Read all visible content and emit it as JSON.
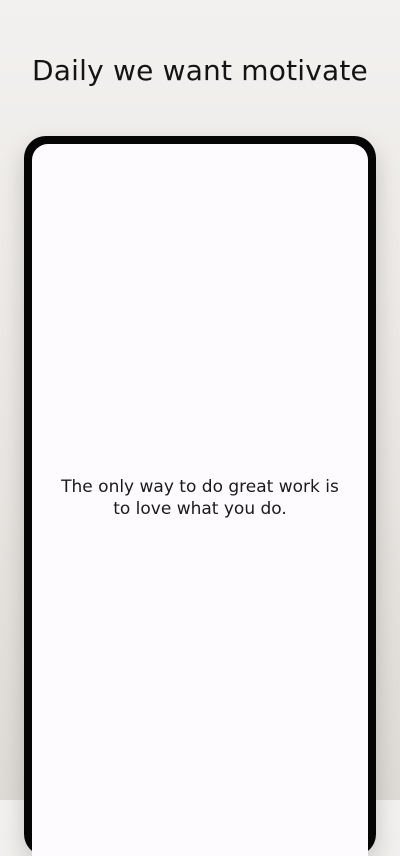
{
  "header": {
    "title": "Daily we want motivate"
  },
  "device": {
    "quote": "The only way to do great work is to love what you do."
  },
  "colors": {
    "background_top": "#f3f1ef",
    "background_bottom": "#dedad6",
    "phone_frame": "#050505",
    "screen": "#fdfbfd",
    "text": "#141414"
  }
}
